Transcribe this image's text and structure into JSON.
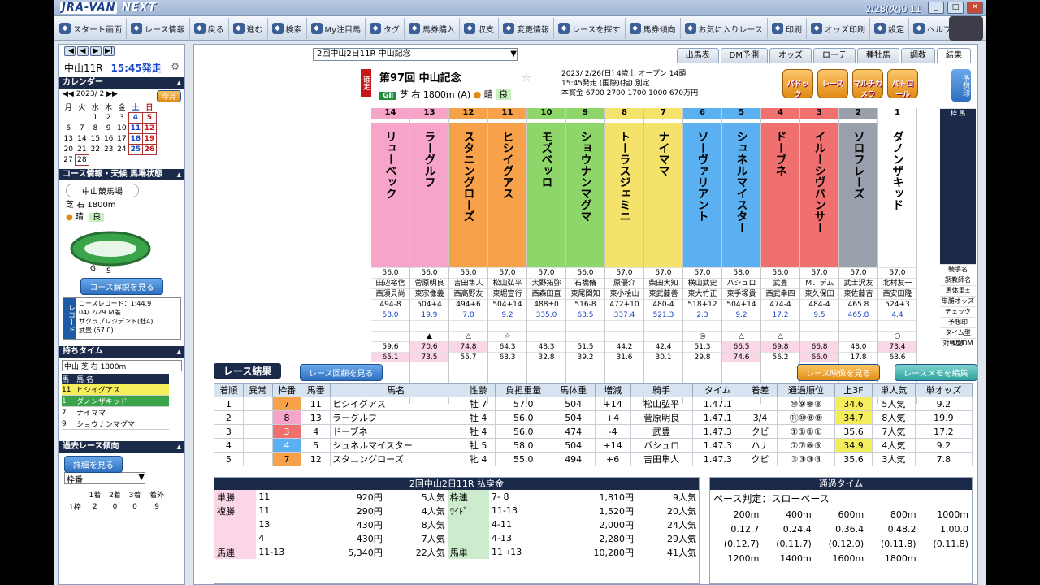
{
  "app": {
    "title": "JRA-VAN NEXT",
    "datetime": "2/28(火)0 11"
  },
  "toolbar": [
    "スタート画面",
    "レース情報",
    "戻る",
    "進む",
    "検索",
    "My注目馬",
    "タグ",
    "馬券購入",
    "収支",
    "変更情報",
    "レースを探す",
    "馬券傾向",
    "お気に入りレース",
    "印刷",
    "オッズ印刷",
    "設定",
    "ヘルプ"
  ],
  "left": {
    "race_label": "中山11R",
    "race_time": "15:45発走",
    "cal_title": "カレンダー",
    "cal_month": "2023/ 2",
    "today_btn": "今月",
    "weekdays": [
      "月",
      "火",
      "水",
      "木",
      "金",
      "土",
      "日"
    ],
    "course_title": "コース情報・天候 馬場状態",
    "venue": "中山競馬場",
    "course": "芝 右 1800m",
    "weather": "晴",
    "track": "良",
    "course_btn": "コース解説を見る",
    "record_label": "レコード",
    "record_lines": [
      "コースレコード：1:44.9",
      "04/ 2/29 Ｍ差",
      "サクラプレジデント(牡4)",
      "武豊 (57.0)"
    ],
    "time_title": "持ちタイム",
    "time_filter": "中山 芝 右 1800m",
    "time_head": [
      "馬",
      "馬 名"
    ],
    "time_rows": [
      [
        "11",
        "ヒシイグアス"
      ],
      [
        "1",
        "ダノンザキッド"
      ],
      [
        "7",
        "ナイママ"
      ],
      [
        "9",
        "ショウナンマグマ"
      ]
    ],
    "trend_title": "過去レース傾向",
    "trend_btn": "詳細を見る",
    "trend_sel": "枠番",
    "trend_cols": [
      "1着",
      "2着",
      "3着",
      "着外"
    ],
    "trend_row": [
      "1枠",
      "2",
      "0",
      "0",
      "9"
    ]
  },
  "main": {
    "combo": "2回中山2日11R 中山記念",
    "tabs": [
      "出馬表",
      "DM予測",
      "オッズ",
      "ローテ",
      "種牡馬",
      "調教",
      "結果"
    ],
    "race_no": "第97回",
    "race_name": "中山記念",
    "grade": "GⅡ",
    "surface": "芝 右 1800m (A)",
    "weather": "晴",
    "track": "良",
    "kakutei": "確定",
    "info": [
      "2023/ 2/26(日)  4歳上 オープン 14頭",
      "15:45発走 (国際)(指) 別定",
      "本賞金 6700 2700 1700 1000 670万円"
    ],
    "buttons": [
      "パドック",
      "レース",
      "マルチカメラ",
      "パトロール"
    ],
    "side_btn": "予想印",
    "horses": [
      {
        "num": "14",
        "waku": "8",
        "name": "リューベック",
        "jockey": "田辺裕信",
        "trainer": "西須貝尚",
        "weight": "56.0",
        "body": "494-8",
        "odds": "58.0",
        "mark": "",
        "dm": "59.6",
        "dm2": "65.1",
        "color": "#f6a5c8"
      },
      {
        "num": "13",
        "waku": "8",
        "name": "ラーグルフ",
        "jockey": "菅原明良",
        "trainer": "東宗像義",
        "weight": "56.0",
        "body": "504+4",
        "odds": "19.9",
        "mark": "▲",
        "dm": "70.6",
        "dm2": "73.5",
        "color": "#f6a5c8"
      },
      {
        "num": "12",
        "waku": "7",
        "name": "スタニングローズ",
        "jockey": "吉田隼人",
        "trainer": "西高野友",
        "weight": "55.0",
        "body": "494+6",
        "odds": "7.8",
        "mark": "△",
        "dm": "74.8",
        "dm2": "55.7",
        "color": "#f7a14a"
      },
      {
        "num": "11",
        "waku": "7",
        "name": "ヒシイグアス",
        "jockey": "松山弘平",
        "trainer": "東堀宣行",
        "weight": "57.0",
        "body": "504+14",
        "odds": "9.2",
        "mark": "☆",
        "dm": "64.3",
        "dm2": "63.3",
        "color": "#f7a14a"
      },
      {
        "num": "10",
        "waku": "6",
        "name": "モズベッロ",
        "jockey": "大野拓弥",
        "trainer": "西森田直",
        "weight": "57.0",
        "body": "488±0",
        "odds": "335.0",
        "mark": "",
        "dm": "48.3",
        "dm2": "32.8",
        "color": "#8ed66a"
      },
      {
        "num": "9",
        "waku": "6",
        "name": "ショウナンマグマ",
        "jockey": "石橋脩",
        "trainer": "東尾関知",
        "weight": "56.0",
        "body": "516-8",
        "odds": "63.5",
        "mark": "",
        "dm": "51.5",
        "dm2": "39.2",
        "color": "#8ed66a"
      },
      {
        "num": "8",
        "waku": "5",
        "name": "トーラスジェミニ",
        "jockey": "原優介",
        "trainer": "東小桧山",
        "weight": "57.0",
        "body": "472+10",
        "odds": "337.4",
        "mark": "",
        "dm": "44.2",
        "dm2": "31.6",
        "color": "#f4e26a"
      },
      {
        "num": "7",
        "waku": "5",
        "name": "ナイママ",
        "jockey": "柴田大知",
        "trainer": "東武藤善",
        "weight": "57.0",
        "body": "480-4",
        "odds": "521.3",
        "mark": "",
        "dm": "42.4",
        "dm2": "30.1",
        "color": "#f4e26a"
      },
      {
        "num": "6",
        "waku": "4",
        "name": "ソーヴァリアント",
        "jockey": "横山武史",
        "trainer": "東大竹正",
        "weight": "57.0",
        "body": "518+12",
        "odds": "2.3",
        "mark": "◎",
        "dm": "51.3",
        "dm2": "29.8",
        "color": "#5ab0f0"
      },
      {
        "num": "5",
        "waku": "4",
        "name": "シュネルマイスター",
        "jockey": "バシュロ",
        "trainer": "東手塚貴",
        "weight": "58.0",
        "body": "504+14",
        "odds": "9.2",
        "mark": "△",
        "dm": "66.5",
        "dm2": "74.6",
        "color": "#5ab0f0"
      },
      {
        "num": "4",
        "waku": "3",
        "name": "ドーブネ",
        "jockey": "武豊",
        "trainer": "西武幸四",
        "weight": "56.0",
        "body": "474-4",
        "odds": "17.2",
        "mark": "△",
        "dm": "69.8",
        "dm2": "56.2",
        "color": "#f07070"
      },
      {
        "num": "3",
        "waku": "3",
        "name": "イルーシヴパンサー",
        "jockey": "Ｍ．デム",
        "trainer": "東久保田",
        "weight": "57.0",
        "body": "484-4",
        "odds": "9.5",
        "mark": "",
        "dm": "66.8",
        "dm2": "66.0",
        "color": "#f07070"
      },
      {
        "num": "2",
        "waku": "2",
        "name": "ソロフレーズ",
        "jockey": "武士沢友",
        "trainer": "東佐藤吉",
        "weight": "57.0",
        "body": "465.8",
        "odds": "465.8",
        "mark": "",
        "dm": "48.0",
        "dm2": "17.8",
        "color": "#9aa0ab"
      },
      {
        "num": "1",
        "waku": "1",
        "name": "ダノンザキッド",
        "jockey": "北村友一",
        "trainer": "西安田隆",
        "weight": "57.0",
        "body": "524+3",
        "odds": "4.4",
        "mark": "○",
        "dm": "73.4",
        "dm2": "63.6",
        "color": "#ffffff"
      }
    ],
    "row_labels": [
      "枠 馬",
      "騎手名",
      "調教師名",
      "馬体重±",
      "単勝オッズ",
      "チェック",
      "予想印",
      "タイム型DM",
      "対戦型DM"
    ],
    "result_title": "レース結果",
    "result_btn": "レース回顧を見る",
    "video_btn": "レース映像を見る",
    "memo_btn": "レースメモを編集",
    "result_cols": [
      "着順",
      "異常",
      "枠番",
      "馬番",
      "馬名",
      "性齢",
      "負担重量",
      "馬体重",
      "増減",
      "騎手",
      "タイム",
      "着差",
      "通過順位",
      "上3F",
      "単人気",
      "単オッズ"
    ],
    "results": [
      [
        "1",
        "",
        "7",
        "11",
        "ヒシイグアス",
        "牡 7",
        "57.0",
        "504",
        "+14",
        "松山弘平",
        "1.47.1",
        "",
        "⑩⑨⑧⑧",
        "34.6",
        "5人気",
        "9.2"
      ],
      [
        "2",
        "",
        "8",
        "13",
        "ラーグルフ",
        "牡 4",
        "56.0",
        "504",
        "+4",
        "菅原明良",
        "1.47.1",
        "3/4",
        "⑪⑩⑧⑧",
        "34.7",
        "8人気",
        "19.9"
      ],
      [
        "3",
        "",
        "3",
        "4",
        "ドーブネ",
        "牡 4",
        "56.0",
        "474",
        "-4",
        "武豊",
        "1.47.3",
        "クビ",
        "①①①①",
        "35.6",
        "7人気",
        "17.2"
      ],
      [
        "4",
        "",
        "4",
        "5",
        "シュネルマイスター",
        "牡 5",
        "58.0",
        "504",
        "+14",
        "バシュロ",
        "1.47.3",
        "ハナ",
        "⑦⑦⑧⑧",
        "34.9",
        "4人気",
        "9.2"
      ],
      [
        "5",
        "",
        "7",
        "12",
        "スタニングローズ",
        "牝 4",
        "55.0",
        "494",
        "+6",
        "吉田隼人",
        "1.47.3",
        "クビ",
        "③③③③",
        "35.6",
        "3人気",
        "7.8"
      ]
    ],
    "payout_title": "2回中山2日11R 払戻金",
    "payouts": [
      [
        "単勝",
        "11",
        "920円",
        "5人気",
        "枠連",
        "7- 8",
        "1,810円",
        "9人気"
      ],
      [
        "複勝",
        "11",
        "290円",
        "4人気",
        "ﾜｲﾄﾞ",
        "11-13",
        "1,520円",
        "20人気"
      ],
      [
        "",
        "13",
        "430円",
        "8人気",
        "",
        "4-11",
        "2,000円",
        "24人気"
      ],
      [
        "",
        "4",
        "430円",
        "7人気",
        "",
        "4-13",
        "2,280円",
        "29人気"
      ],
      [
        "馬連",
        "11-13",
        "5,340円",
        "22人気",
        "馬単",
        "11→13",
        "10,280円",
        "41人気"
      ]
    ],
    "pass_title": "通過タイム",
    "pace": "ペース判定：スローペース",
    "pass_dist1": [
      "200m",
      "400m",
      "600m",
      "800m",
      "1000m"
    ],
    "pass_t1": [
      "0.12.7",
      "0.24.4",
      "0.36.4",
      "0.48.2",
      "1.00.0"
    ],
    "pass_l1": [
      "(0.12.7)",
      "(0.11.7)",
      "(0.12.0)",
      "(0.11.8)",
      "(0.11.8)"
    ],
    "pass_dist2": [
      "1200m",
      "1400m",
      "1600m",
      "1800m",
      ""
    ]
  }
}
